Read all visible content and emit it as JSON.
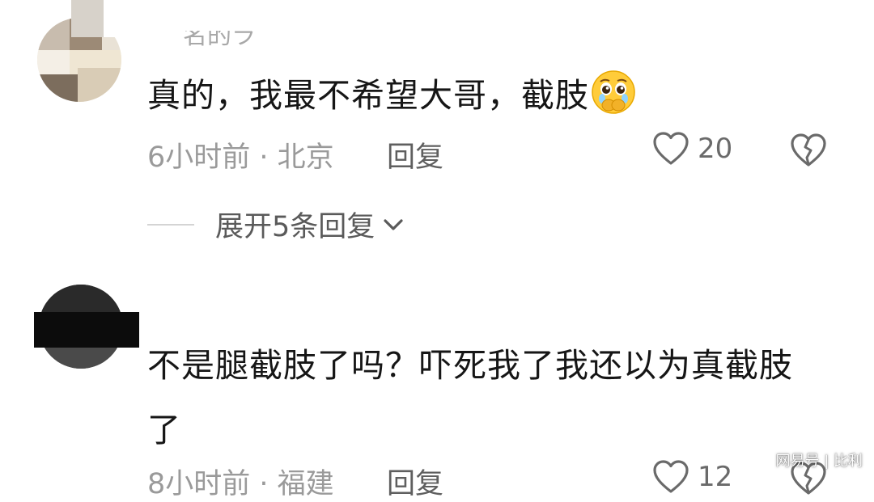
{
  "comments": [
    {
      "username": "名的ラ",
      "text": "真的，我最不希望大哥，截肢",
      "emoji": "pleading-face-crying-emoji",
      "time_location": "6小时前 · 北京",
      "reply_label": "回复",
      "like_count": "20",
      "expand_replies_label": "展开5条回复"
    },
    {
      "text": "不是腿截肢了吗？吓死我了我还以为真截肢了",
      "time_location": "8小时前 · 福建",
      "reply_label": "回复",
      "like_count": "12"
    }
  ],
  "watermark": "网易号 | 比利",
  "colors": {
    "text_primary": "#161616",
    "text_meta": "#9a9a9a",
    "icon_gray": "#6a6a6a",
    "background": "#ffffff"
  },
  "icons": {
    "like": "heart-outline-icon",
    "dislike": "broken-heart-icon",
    "expand": "chevron-down-icon"
  }
}
